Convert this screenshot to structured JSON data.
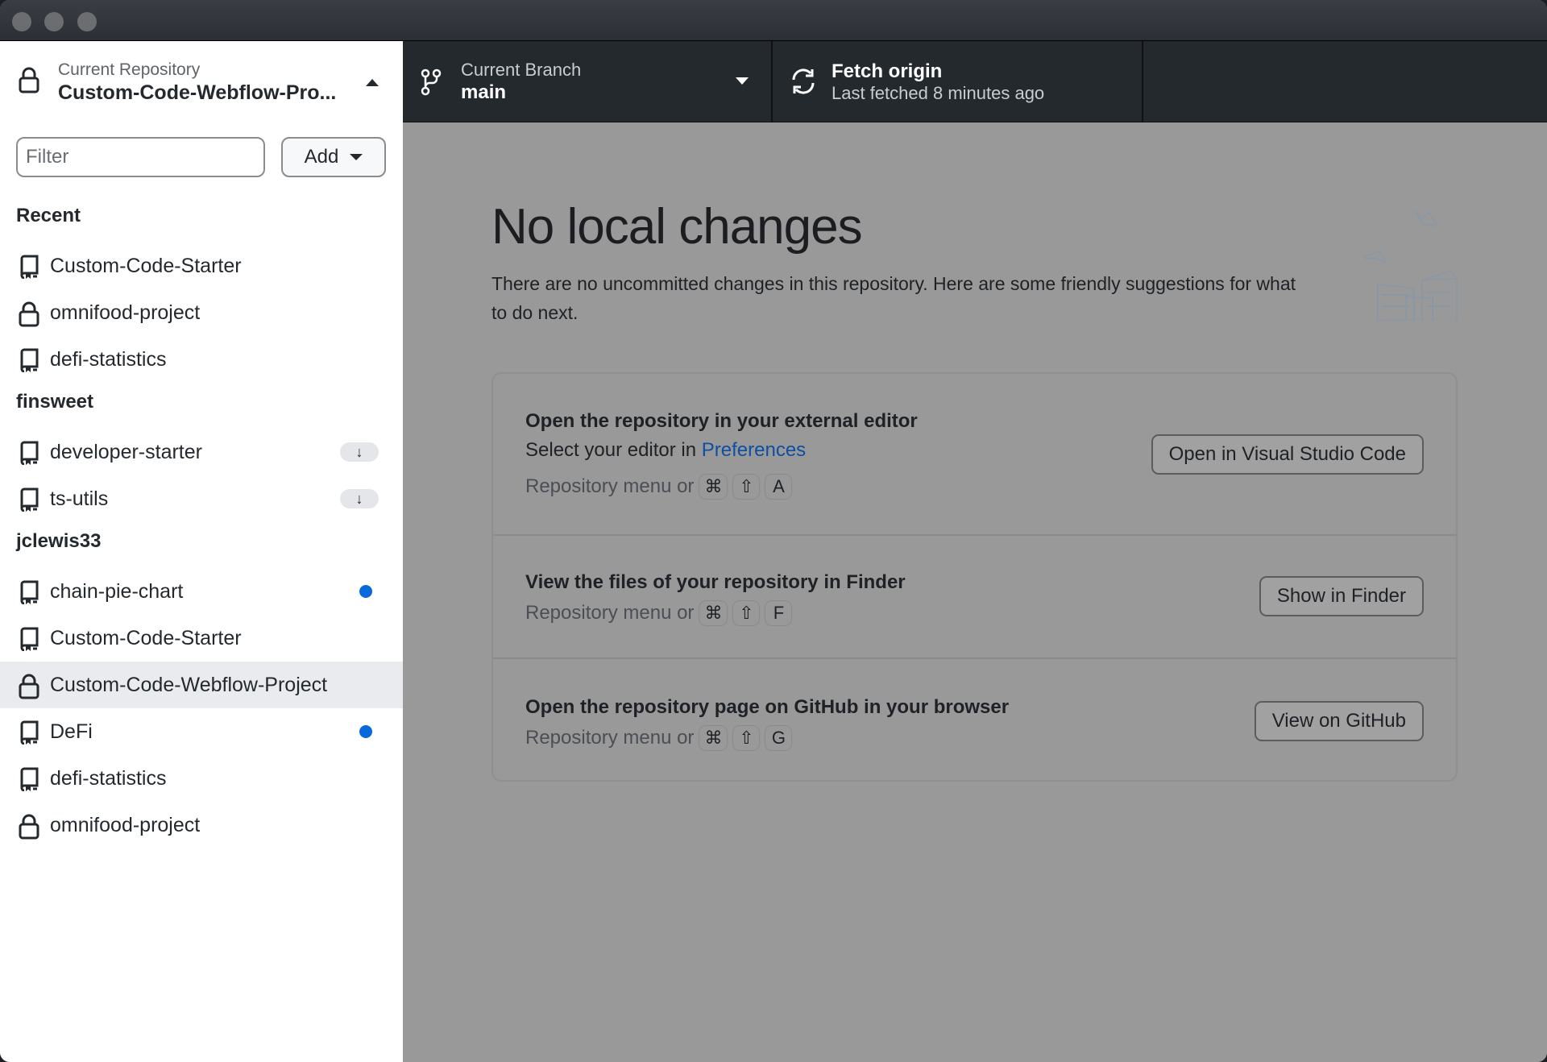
{
  "window": {
    "traffic_lights": [
      "close",
      "minimize",
      "zoom"
    ]
  },
  "sidebar": {
    "repo_header": {
      "label": "Current Repository",
      "name": "Custom-Code-Webflow-Pro...",
      "icon": "lock-icon"
    },
    "filter": {
      "placeholder": "Filter",
      "value": ""
    },
    "add_button": {
      "label": "Add"
    },
    "groups": [
      {
        "title": "Recent",
        "items": [
          {
            "name": "Custom-Code-Starter",
            "icon": "repo",
            "badge": null
          },
          {
            "name": "omnifood-project",
            "icon": "lock",
            "badge": null
          },
          {
            "name": "defi-statistics",
            "icon": "repo",
            "badge": null
          }
        ]
      },
      {
        "title": "finsweet",
        "items": [
          {
            "name": "developer-starter",
            "icon": "repo",
            "badge": "download"
          },
          {
            "name": "ts-utils",
            "icon": "repo",
            "badge": "download"
          }
        ]
      },
      {
        "title": "jclewis33",
        "items": [
          {
            "name": "chain-pie-chart",
            "icon": "repo",
            "badge": "dot"
          },
          {
            "name": "Custom-Code-Starter",
            "icon": "repo",
            "badge": null
          },
          {
            "name": "Custom-Code-Webflow-Project",
            "icon": "lock",
            "badge": null,
            "selected": true
          },
          {
            "name": "DeFi",
            "icon": "repo",
            "badge": "dot"
          },
          {
            "name": "defi-statistics",
            "icon": "repo",
            "badge": null
          },
          {
            "name": "omnifood-project",
            "icon": "lock",
            "badge": null
          }
        ]
      }
    ],
    "download_glyph": "↓"
  },
  "toolbar": {
    "branch": {
      "label": "Current Branch",
      "value": "main"
    },
    "fetch": {
      "label": "Fetch origin",
      "sub": "Last fetched 8 minutes ago"
    }
  },
  "main": {
    "title": "No local changes",
    "description": "There are no uncommitted changes in this repository. Here are some friendly suggestions for what to do next.",
    "suggestions": [
      {
        "title": "Open the repository in your external editor",
        "sub_prefix": "Select your editor in ",
        "sub_link": "Preferences",
        "hint": "Repository menu or",
        "keys": [
          "⌘",
          "⇧",
          "A"
        ],
        "button": "Open in Visual Studio Code"
      },
      {
        "title": "View the files of your repository in Finder",
        "hint": "Repository menu or",
        "keys": [
          "⌘",
          "⇧",
          "F"
        ],
        "button": "Show in Finder"
      },
      {
        "title": "Open the repository page on GitHub in your browser",
        "hint": "Repository menu or",
        "keys": [
          "⌘",
          "⇧",
          "G"
        ],
        "button": "View on GitHub"
      }
    ]
  },
  "colors": {
    "accent_blue": "#0969da",
    "link_blue": "#0e4fa3",
    "toolbar_bg": "#24292e",
    "overlay_bg": "#999999",
    "selected_row": "#e9ebee"
  }
}
